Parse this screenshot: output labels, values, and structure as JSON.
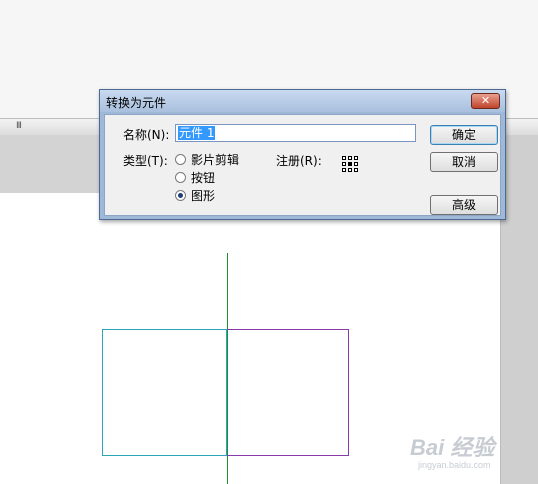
{
  "toolbar": {
    "grip": "III"
  },
  "dialog": {
    "title": "转换为元件",
    "close_glyph": "✕",
    "name_label": "名称(N):",
    "name_value": "元件 1",
    "type_label": "类型(T):",
    "type_options": [
      "影片剪辑",
      "按钮",
      "图形"
    ],
    "type_selected": "图形",
    "registration_label": "注册(R):",
    "registration_point": "center",
    "buttons": {
      "ok": "确定",
      "cancel": "取消",
      "advanced": "高级"
    }
  },
  "watermark": {
    "logo": "Bai 经验",
    "url": "jingyan.baidu.com"
  },
  "colors": {
    "guide_line": "#1f8f2f",
    "left_shape_stroke": "#2aa6b8",
    "right_shape_stroke": "#8a3aa8"
  }
}
